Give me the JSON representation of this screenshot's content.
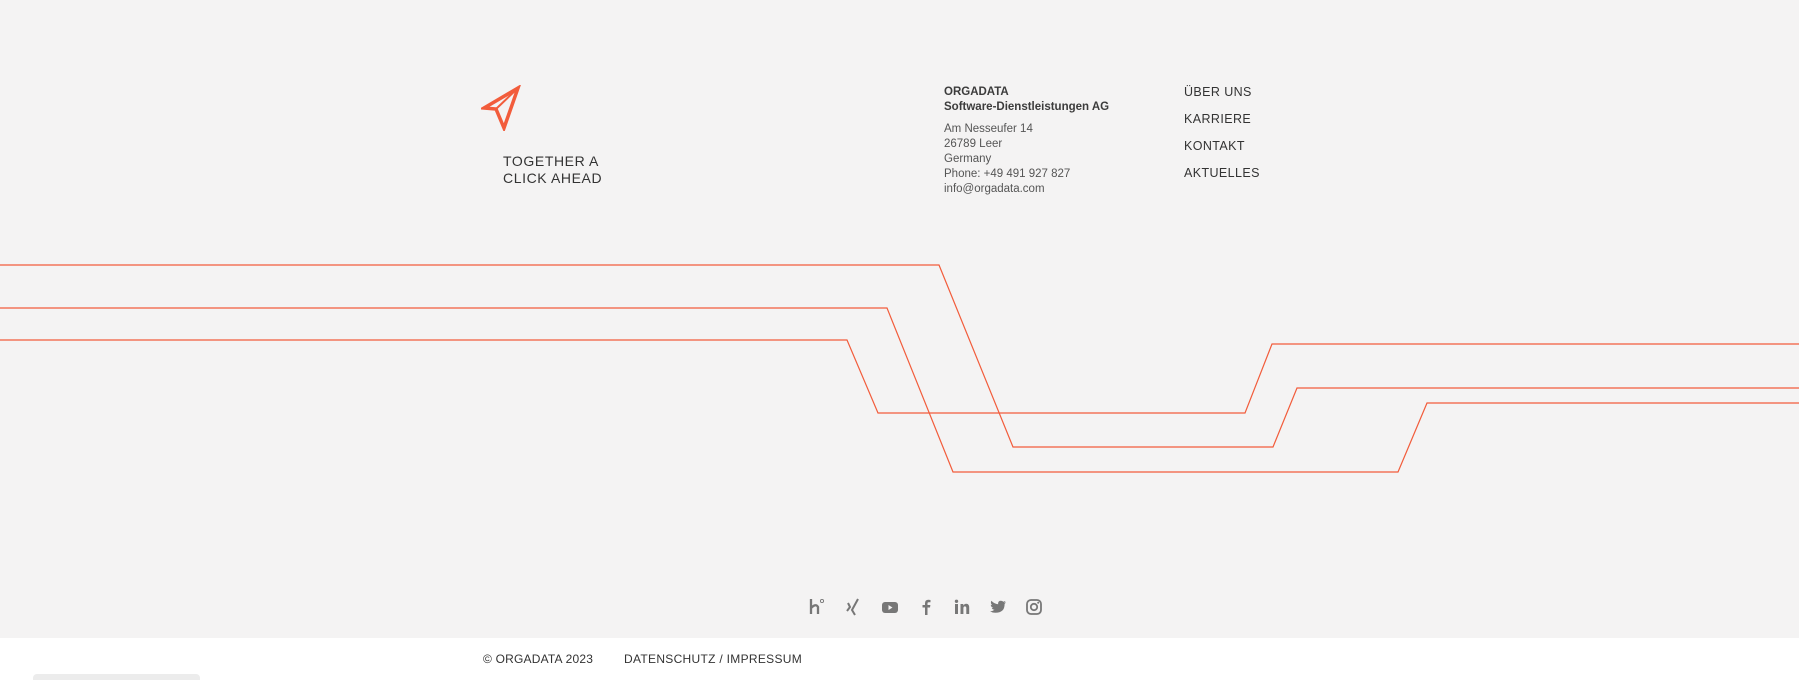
{
  "brand": {
    "tagline_line1": "TOGETHER A",
    "tagline_line2": "CLICK AHEAD",
    "accent_color": "#f25c3b"
  },
  "company": {
    "name": "ORGADATA",
    "subtitle": "Software-Dienstleistungen AG",
    "street": "Am Nesseufer 14",
    "city": "26789 Leer",
    "country": "Germany",
    "phone": "Phone: +49 491 927 827",
    "email": "info@orgadata.com"
  },
  "nav": {
    "items": [
      {
        "label": "ÜBER UNS"
      },
      {
        "label": "KARRIERE"
      },
      {
        "label": "KONTAKT"
      },
      {
        "label": "AKTUELLES"
      }
    ]
  },
  "social": {
    "icons": [
      "kununu-icon",
      "xing-icon",
      "youtube-icon",
      "facebook-icon",
      "linkedin-icon",
      "twitter-icon",
      "instagram-icon"
    ],
    "icon_color": "#777777"
  },
  "bottom": {
    "copyright": "© ORGADATA 2023",
    "legal_link": "DATENSCHUTZ / IMPRESSUM"
  }
}
